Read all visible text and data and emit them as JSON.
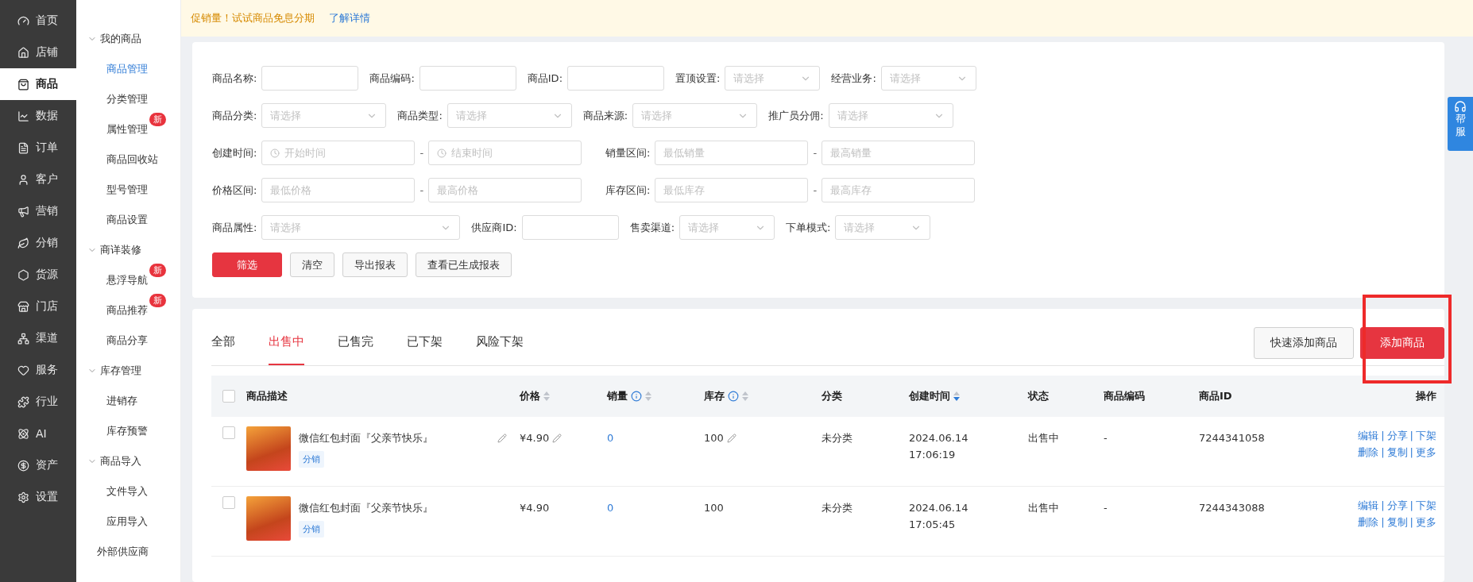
{
  "nav": {
    "items": [
      {
        "label": "首页",
        "selected": false
      },
      {
        "label": "店铺",
        "selected": false
      },
      {
        "label": "商品",
        "selected": true
      },
      {
        "label": "数据",
        "selected": false
      },
      {
        "label": "订单",
        "selected": false
      },
      {
        "label": "客户",
        "selected": false
      },
      {
        "label": "营销",
        "selected": false
      },
      {
        "label": "分销",
        "selected": false
      },
      {
        "label": "货源",
        "selected": false
      },
      {
        "label": "门店",
        "selected": false
      },
      {
        "label": "渠道",
        "selected": false
      },
      {
        "label": "服务",
        "selected": false
      },
      {
        "label": "行业",
        "selected": false
      },
      {
        "label": "AI",
        "selected": false
      },
      {
        "label": "资产",
        "selected": false
      },
      {
        "label": "设置",
        "selected": false
      }
    ]
  },
  "subnav": {
    "groups": [
      {
        "title": "我的商品",
        "expanded": true,
        "children": [
          {
            "label": "商品管理",
            "selected": true
          },
          {
            "label": "分类管理",
            "selected": false
          },
          {
            "label": "属性管理",
            "selected": false,
            "badge": "新"
          },
          {
            "label": "商品回收站",
            "selected": false
          },
          {
            "label": "型号管理",
            "selected": false
          },
          {
            "label": "商品设置",
            "selected": false
          }
        ]
      },
      {
        "title": "商详装修",
        "expanded": true,
        "children": [
          {
            "label": "悬浮导航",
            "selected": false,
            "badge": "新"
          },
          {
            "label": "商品推荐",
            "selected": false,
            "badge": "新"
          },
          {
            "label": "商品分享",
            "selected": false
          }
        ]
      },
      {
        "title": "库存管理",
        "expanded": true,
        "children": [
          {
            "label": "进销存",
            "selected": false
          },
          {
            "label": "库存预警",
            "selected": false
          }
        ]
      },
      {
        "title": "商品导入",
        "expanded": true,
        "children": [
          {
            "label": "文件导入",
            "selected": false
          },
          {
            "label": "应用导入",
            "selected": false
          }
        ]
      },
      {
        "title": "外部供应商"
      }
    ]
  },
  "notice": {
    "text": "促销量！试试商品免息分期",
    "link": "了解详情"
  },
  "filters": [
    [
      {
        "label": "商品名称:",
        "kind": "text"
      },
      {
        "label": "商品编码:",
        "kind": "text"
      },
      {
        "label": "商品ID:",
        "kind": "text"
      },
      {
        "label": "置顶设置:",
        "kind": "select",
        "placeholder": "请选择"
      },
      {
        "label": "经营业务:",
        "kind": "select",
        "placeholder": "请选择"
      }
    ],
    [
      {
        "label": "商品分类:",
        "kind": "select",
        "placeholder": "请选择"
      },
      {
        "label": "商品类型:",
        "kind": "select",
        "placeholder": "请选择"
      },
      {
        "label": "商品来源:",
        "kind": "select",
        "placeholder": "请选择"
      },
      {
        "label": "推广员分佣:",
        "kind": "select",
        "placeholder": "请选择"
      }
    ],
    [
      {
        "label": "创建时间:",
        "kind": "date_range",
        "placeholders": [
          "开始时间",
          "结束时间"
        ],
        "separator": "-"
      },
      {
        "label": "销量区间:",
        "kind": "range",
        "placeholders": [
          "最低销量",
          "最高销量"
        ],
        "separator": "-"
      }
    ],
    [
      {
        "label": "价格区间:",
        "kind": "range",
        "placeholders": [
          "最低价格",
          "最高价格"
        ],
        "separator": "-"
      },
      {
        "label": "库存区间:",
        "kind": "range",
        "placeholders": [
          "最低库存",
          "最高库存"
        ],
        "separator": "-"
      }
    ],
    [
      {
        "label": "商品属性:",
        "kind": "wide_select",
        "placeholder": "请选择"
      },
      {
        "label": "供应商ID:",
        "kind": "text"
      },
      {
        "label": "售卖渠道:",
        "kind": "select",
        "placeholder": "请选择"
      },
      {
        "label": "下单模式:",
        "kind": "select",
        "placeholder": "请选择"
      }
    ]
  ],
  "filter_buttons": [
    {
      "label": "筛选",
      "kind": "primary"
    },
    {
      "label": "清空",
      "kind": "default"
    },
    {
      "label": "导出报表",
      "kind": "default"
    },
    {
      "label": "查看已生成报表",
      "kind": "default"
    }
  ],
  "help_tab": {
    "lines": [
      "帮",
      "服"
    ]
  },
  "tabs": [
    {
      "label": "全部",
      "selected": false
    },
    {
      "label": "出售中",
      "selected": true
    },
    {
      "label": "已售完",
      "selected": false
    },
    {
      "label": "已下架",
      "selected": false
    },
    {
      "label": "风险下架",
      "selected": false
    }
  ],
  "actions": [
    {
      "label": "快速添加商品",
      "kind": "default",
      "highlighted": false
    },
    {
      "label": "添加商品",
      "kind": "primary",
      "highlighted": true
    }
  ],
  "table": {
    "columns": [
      {
        "label": "商品描述"
      },
      {
        "label": "价格",
        "sortable": true,
        "sorted": false
      },
      {
        "label": "销量",
        "info": true,
        "sortable": true,
        "sorted": false
      },
      {
        "label": "库存",
        "info": true,
        "sortable": true,
        "sorted": false
      },
      {
        "label": "分类"
      },
      {
        "label": "创建时间",
        "sortable": true,
        "sorted": true
      },
      {
        "label": "状态"
      },
      {
        "label": "商品编码"
      },
      {
        "label": "商品ID"
      },
      {
        "label": "操作"
      }
    ],
    "op_separator": "|",
    "header_checked": false,
    "rows": [
      {
        "checked": false,
        "name": "微信红包封面『父亲节快乐』",
        "editable": true,
        "tag": "分销",
        "price": "¥4.90",
        "sales": "0",
        "stock": "100",
        "category": "未分类",
        "created": [
          "2024.06.14",
          "17:06:19"
        ],
        "status": "出售中",
        "code": "-",
        "id": "7244341058",
        "ops": [
          [
            "编辑",
            "分享",
            "下架"
          ],
          [
            "删除",
            "复制",
            "更多"
          ]
        ]
      },
      {
        "checked": false,
        "name": "微信红包封面『父亲节快乐』",
        "editable": false,
        "tag": "分销",
        "price": "¥4.90",
        "sales": "0",
        "stock": "100",
        "category": "未分类",
        "created": [
          "2024.06.14",
          "17:05:45"
        ],
        "status": "出售中",
        "code": "-",
        "id": "7244343088",
        "ops": [
          [
            "编辑",
            "分享",
            "下架"
          ],
          [
            "删除",
            "复制",
            "更多"
          ]
        ]
      }
    ]
  }
}
